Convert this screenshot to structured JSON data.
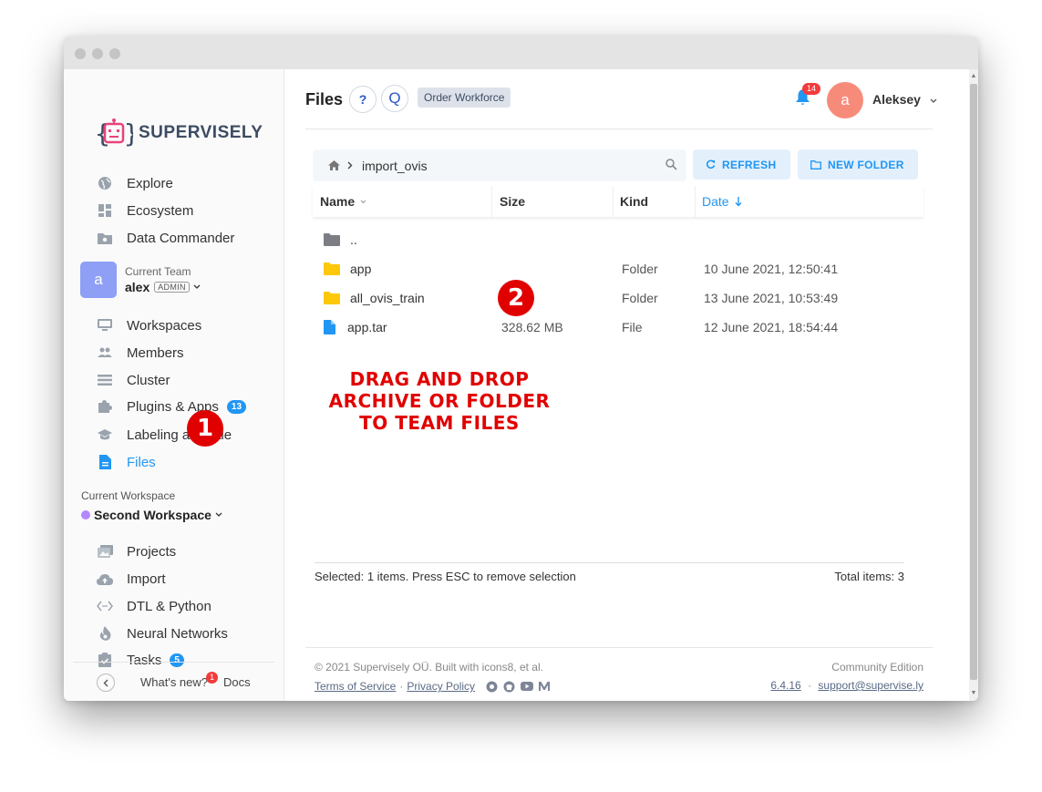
{
  "logo": {
    "text": "SUPERVISELY"
  },
  "nav_top": [
    {
      "label": "Explore",
      "icon": "globe-icon"
    },
    {
      "label": "Ecosystem",
      "icon": "grid-icon"
    },
    {
      "label": "Data Commander",
      "icon": "folder-star-icon"
    }
  ],
  "team": {
    "label": "Current Team",
    "avatar": "a",
    "name": "alex",
    "role": "ADMIN"
  },
  "nav_team": [
    {
      "label": "Workspaces",
      "icon": "monitor-icon"
    },
    {
      "label": "Members",
      "icon": "people-icon"
    },
    {
      "label": "Cluster",
      "icon": "list-icon"
    },
    {
      "label": "Plugins & Apps",
      "icon": "puzzle-icon",
      "badge": "13"
    },
    {
      "label": "Labeling at Scale",
      "icon": "school-icon"
    },
    {
      "label": "Files",
      "icon": "file-icon",
      "active": true
    }
  ],
  "workspace": {
    "label": "Current Workspace",
    "name": "Second Workspace",
    "dot_color": "#b388ff"
  },
  "nav_ws": [
    {
      "label": "Projects",
      "icon": "images-icon"
    },
    {
      "label": "Import",
      "icon": "cloud-upload-icon"
    },
    {
      "label": "DTL & Python",
      "icon": "code-icon"
    },
    {
      "label": "Neural Networks",
      "icon": "flame-icon"
    },
    {
      "label": "Tasks",
      "icon": "clipboard-check-icon",
      "badge": "5"
    }
  ],
  "sidebar_footer": {
    "whats_new": "What's new?",
    "whats_new_badge": "1",
    "docs": "Docs"
  },
  "markers": {
    "one": "1",
    "two": "2"
  },
  "header": {
    "title": "Files",
    "help_label": "?",
    "q_label": "Q",
    "order_workforce": "Order Workforce",
    "notifications": "14",
    "user_avatar": "a",
    "user_name": "Aleksey"
  },
  "pathbar": {
    "folder": "import_ovis"
  },
  "buttons": {
    "refresh": "REFRESH",
    "new_folder": "NEW FOLDER"
  },
  "table": {
    "headers": {
      "name": "Name",
      "size": "Size",
      "kind": "Kind",
      "date": "Date"
    },
    "rows": [
      {
        "name": "..",
        "size": "",
        "kind": "",
        "date": "",
        "type": "folder-grey"
      },
      {
        "name": "app",
        "size": "",
        "kind": "Folder",
        "date": "10 June 2021, 12:50:41",
        "type": "folder"
      },
      {
        "name": "all_ovis_train",
        "size": "",
        "kind": "Folder",
        "date": "13 June 2021, 10:53:49",
        "type": "folder"
      },
      {
        "name": "app.tar",
        "size": "328.62 MB",
        "kind": "File",
        "date": "12 June 2021, 18:54:44",
        "type": "file"
      }
    ],
    "selected_text": "Selected: 1 items. Press ESC to remove selection",
    "total_text": "Total items: 3"
  },
  "annotation": {
    "lines": [
      "DRAG AND DROP",
      "ARCHIVE OR FOLDER",
      "TO TEAM FILES"
    ]
  },
  "footer": {
    "copyright": "© 2021 Supervisely OÜ. Built with icons8, et al.",
    "terms": "Terms of Service",
    "privacy": "Privacy Policy",
    "edition": "Community Edition",
    "version": "6.4.16",
    "support": "support@supervise.ly"
  },
  "colors": {
    "accent": "#2196f3",
    "marker_red": "#e10000",
    "logo_pink": "#e8437a"
  }
}
